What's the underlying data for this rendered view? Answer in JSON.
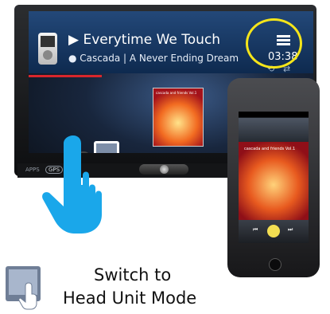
{
  "head_unit": {
    "song_title": "Everytime We Touch",
    "artist_line": "Cascada  |  A Never Ending Dream",
    "time": "03:38",
    "album_text": "cascada and friends Vol.1",
    "apps_label": "APPS",
    "gps_label": "GPS",
    "icons": {
      "play": "play-icon",
      "person": "person-icon",
      "menu": "menu-icon",
      "repeat": "repeat-icon",
      "shuffle": "shuffle-icon"
    }
  },
  "phone": {
    "art_title": "cascada and friends Vol.1",
    "prev": "⏮",
    "next": "⏭"
  },
  "caption": {
    "line1": "Switch to",
    "line2": "Head Unit Mode"
  },
  "colors": {
    "highlight": "#f5e51a",
    "hand": "#1aa7ea",
    "progress": "#d8262c"
  }
}
